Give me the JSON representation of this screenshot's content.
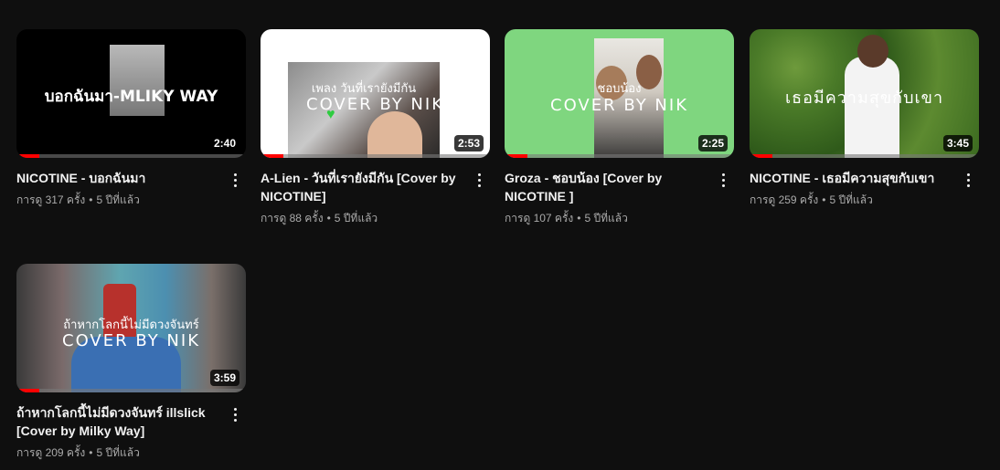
{
  "videos": [
    {
      "title": "NICOTINE - บอกฉันมา",
      "views": "การดู 317 ครั้ง",
      "age": "5 ปีที่แล้ว",
      "duration": "2:40",
      "progress": 0.1,
      "thumb_text": "บอกฉันมา-MLIKY WAY"
    },
    {
      "title": "A-Lien - วันที่เรายังมีกัน [Cover by NICOTINE]",
      "views": "การดู 88 ครั้ง",
      "age": "5 ปีที่แล้ว",
      "duration": "2:53",
      "progress": 0.1,
      "thumb_text": "เพลง วันที่เรายังมีกัน",
      "thumb_sub": "COVER BY NIK"
    },
    {
      "title": "Groza - ชอบน้อง [Cover by NICOTINE ]",
      "views": "การดู 107 ครั้ง",
      "age": "5 ปีที่แล้ว",
      "duration": "2:25",
      "progress": 0.1,
      "thumb_text": "ชอบน้อง",
      "thumb_sub": "COVER BY NIK"
    },
    {
      "title": "NICOTINE - เธอมีความสุขกับเขา",
      "views": "การดู 259 ครั้ง",
      "age": "5 ปีที่แล้ว",
      "duration": "3:45",
      "progress": 0.1,
      "thumb_text": "เธอมีความสุขกับเขา"
    },
    {
      "title": "ถ้าหากโลกนี้ไม่มีดวงจันทร์ illslick [Cover by Milky Way]",
      "views": "การดู 209 ครั้ง",
      "age": "5 ปีที่แล้ว",
      "duration": "3:59",
      "progress": 0.1,
      "thumb_text": "ถ้าหากโลกนี้ไม่มีดวงจันทร์",
      "thumb_sub": "COVER BY NIK"
    }
  ],
  "icons": {
    "menu": "vertical-dots-icon"
  },
  "colors": {
    "background": "#0f0f0f",
    "progress": "#ff0000",
    "meta_text": "#aaaaaa",
    "thumb3_bg": "#7fd67f"
  }
}
